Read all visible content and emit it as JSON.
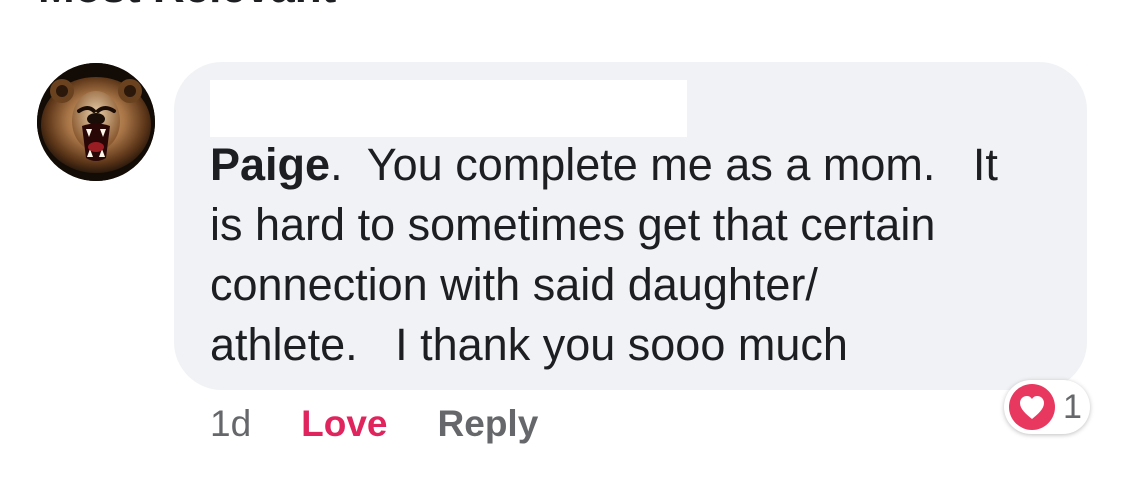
{
  "header": {
    "title": "Most Relevant"
  },
  "comment": {
    "avatar_icon": "bear-face-avatar",
    "author_hidden": true,
    "mention": "Paige",
    "text_lines": [
      ".  You complete me as a mom.   It",
      "is hard to sometimes get that certain",
      "connection with said daughter/",
      "athlete.   I thank you sooo much"
    ],
    "timestamp": "1d",
    "actions": {
      "love": "Love",
      "reply": "Reply"
    },
    "reaction": {
      "icon": "heart-icon",
      "count": "1"
    }
  },
  "colors": {
    "bubble": "#f0f2f5",
    "love": "#e0245e",
    "heart": "#e8385f",
    "meta": "#65676b",
    "text": "#1c1e21"
  }
}
